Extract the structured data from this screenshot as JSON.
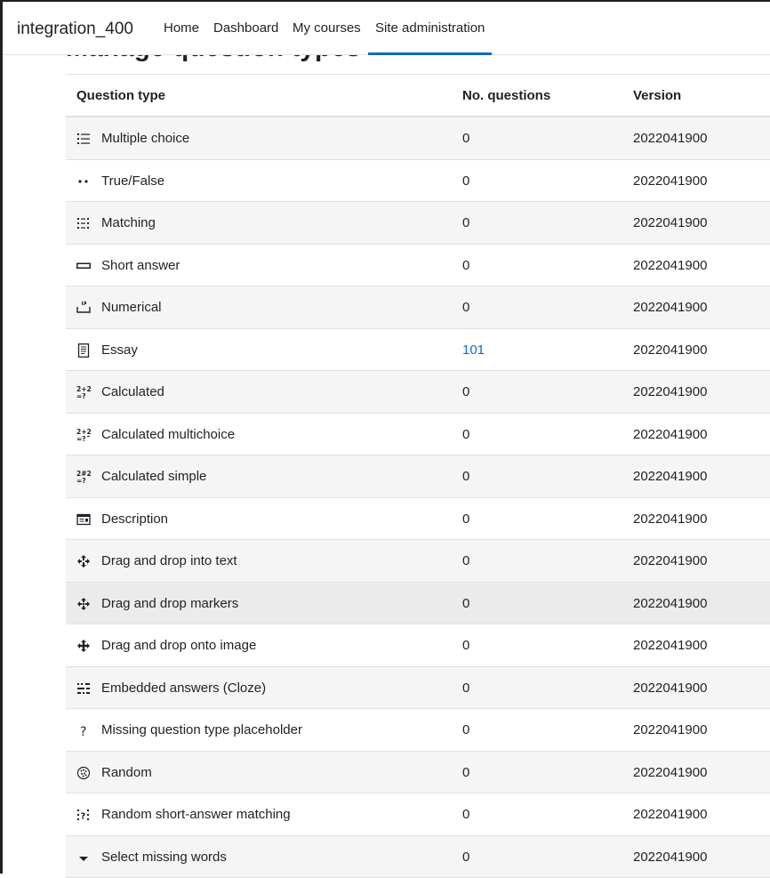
{
  "navbar": {
    "brand": "integration_400",
    "items": [
      {
        "label": "Home"
      },
      {
        "label": "Dashboard"
      },
      {
        "label": "My courses"
      },
      {
        "label": "Site administration"
      }
    ]
  },
  "page": {
    "heading": "Manage question types"
  },
  "table": {
    "columns": [
      "Question type",
      "No. questions",
      "Version"
    ],
    "rows": [
      {
        "icon": "multiple-choice-icon",
        "name": "Multiple choice",
        "count": "0",
        "version": "2022041900"
      },
      {
        "icon": "true-false-icon",
        "name": "True/False",
        "count": "0",
        "version": "2022041900"
      },
      {
        "icon": "matching-icon",
        "name": "Matching",
        "count": "0",
        "version": "2022041900"
      },
      {
        "icon": "short-answer-icon",
        "name": "Short answer",
        "count": "0",
        "version": "2022041900"
      },
      {
        "icon": "numerical-icon",
        "name": "Numerical",
        "count": "0",
        "version": "2022041900"
      },
      {
        "icon": "essay-icon",
        "name": "Essay",
        "count": "101",
        "version": "2022041900"
      },
      {
        "icon": "calculated-icon",
        "name": "Calculated",
        "count": "0",
        "version": "2022041900"
      },
      {
        "icon": "calculated-multichoice-icon",
        "name": "Calculated multichoice",
        "count": "0",
        "version": "2022041900"
      },
      {
        "icon": "calculated-simple-icon",
        "name": "Calculated simple",
        "count": "0",
        "version": "2022041900"
      },
      {
        "icon": "description-icon",
        "name": "Description",
        "count": "0",
        "version": "2022041900"
      },
      {
        "icon": "drag-drop-text-icon",
        "name": "Drag and drop into text",
        "count": "0",
        "version": "2022041900"
      },
      {
        "icon": "drag-drop-markers-icon",
        "name": "Drag and drop markers",
        "count": "0",
        "version": "2022041900"
      },
      {
        "icon": "drag-drop-image-icon",
        "name": "Drag and drop onto image",
        "count": "0",
        "version": "2022041900"
      },
      {
        "icon": "embedded-answers-icon",
        "name": "Embedded answers (Cloze)",
        "count": "0",
        "version": "2022041900"
      },
      {
        "icon": "missing-type-icon",
        "name": "Missing question type placeholder",
        "count": "0",
        "version": "2022041900"
      },
      {
        "icon": "random-icon",
        "name": "Random",
        "count": "0",
        "version": "2022041900"
      },
      {
        "icon": "random-short-answer-matching-icon",
        "name": "Random short-answer matching",
        "count": "0",
        "version": "2022041900"
      },
      {
        "icon": "select-missing-words-icon",
        "name": "Select missing words",
        "count": "0",
        "version": "2022041900"
      }
    ]
  },
  "colors": {
    "accent": "#0f6cbf",
    "stripe": "#f5f5f5",
    "hover": "#ebebeb",
    "text": "#1d2125"
  }
}
